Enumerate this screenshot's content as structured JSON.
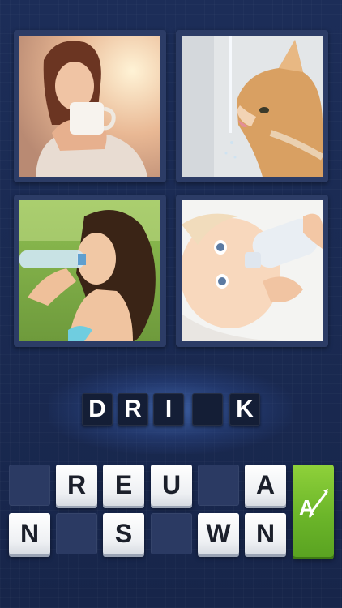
{
  "pictures": [
    {
      "subject": "woman-drinking-coffee",
      "image_icon": "woman-mug-photo"
    },
    {
      "subject": "cat-drinking-water",
      "image_icon": "cat-faucet-photo"
    },
    {
      "subject": "woman-drinking-bottle",
      "image_icon": "woman-bottle-photo"
    },
    {
      "subject": "baby-drinking-bottle",
      "image_icon": "baby-bottle-photo"
    }
  ],
  "answer": {
    "slots": [
      "D",
      "R",
      "I",
      "",
      "K"
    ]
  },
  "letter_rows": [
    [
      "",
      "R",
      "E",
      "U",
      "",
      "A"
    ],
    [
      "N",
      "",
      "S",
      "",
      "W",
      "N"
    ]
  ],
  "hint": {
    "icon": "letter-a-wand-icon",
    "label": "A"
  },
  "colors": {
    "background": "#1a2a52",
    "tile": "#ffffff",
    "hint_green": "#7cc531",
    "slot": "#141e36"
  }
}
